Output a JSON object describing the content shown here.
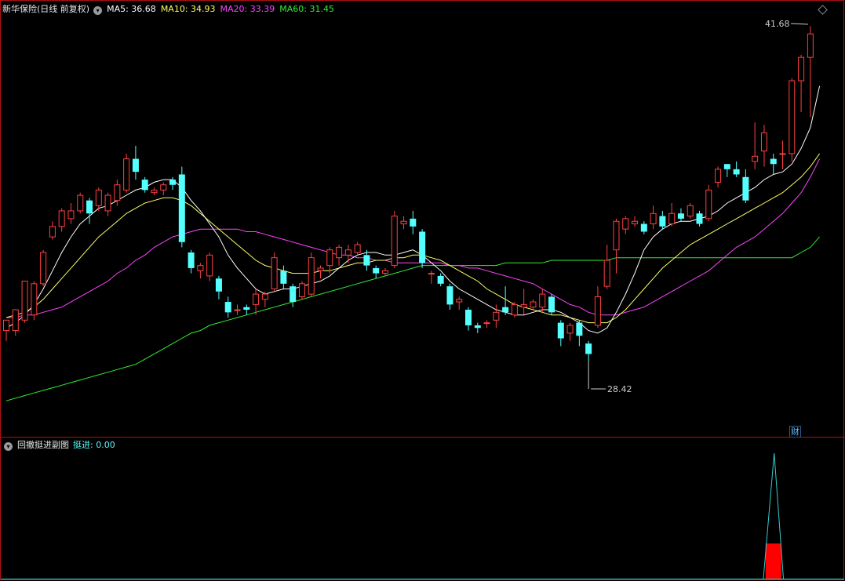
{
  "main_panel": {
    "title": "新华保险(日线 前复权)",
    "ma_values": [
      {
        "label": "MA5: 36.68",
        "color": "#ffffff"
      },
      {
        "label": "MA10: 34.93",
        "color": "#ffff66"
      },
      {
        "label": "MA20: 33.39",
        "color": "#ff44ff"
      },
      {
        "label": "MA60: 31.45",
        "color": "#33ee33"
      }
    ],
    "max_label": "41.68",
    "min_label": "28.42",
    "finance_badge": "财"
  },
  "sub_panel": {
    "title": "回撤挺进副图",
    "indicator_label": "挺进: 0.00"
  },
  "colors": {
    "up": "#ff4040",
    "down": "#54ffff",
    "frame": "#b01010",
    "ma5": "#ffffff",
    "ma10": "#ffff66",
    "ma20": "#ff44ff",
    "ma60": "#33ee33",
    "spike": "#33cccc",
    "bar": "#ff0000"
  },
  "chart_data": {
    "type": "candlestick",
    "y_range": [
      26.0,
      42.2
    ],
    "candles": [
      [
        30.0,
        30.4,
        29.6,
        30.2
      ],
      [
        30.0,
        30.8,
        29.8,
        30.6
      ],
      [
        30.4,
        31.9,
        30.3,
        31.8
      ],
      [
        30.6,
        31.8,
        30.4,
        31.9
      ],
      [
        31.8,
        33.0,
        31.7,
        33.1
      ],
      [
        33.6,
        34.0,
        33.5,
        34.2
      ],
      [
        34.0,
        34.6,
        33.8,
        34.7
      ],
      [
        34.3,
        34.6,
        34.1,
        34.9
      ],
      [
        34.6,
        35.2,
        34.5,
        35.3
      ],
      [
        35.0,
        34.5,
        34.1,
        35.1
      ],
      [
        34.8,
        35.4,
        34.6,
        35.5
      ],
      [
        34.6,
        35.2,
        34.4,
        35.3
      ],
      [
        35.0,
        35.6,
        34.8,
        35.8
      ],
      [
        35.4,
        36.6,
        35.3,
        36.8
      ],
      [
        36.6,
        36.1,
        35.8,
        37.1
      ],
      [
        35.8,
        35.4,
        35.3,
        35.9
      ],
      [
        35.3,
        35.4,
        35.2,
        35.5
      ],
      [
        35.4,
        35.6,
        35.2,
        35.7
      ],
      [
        35.8,
        35.6,
        35.4,
        35.9
      ],
      [
        36.0,
        33.4,
        33.2,
        36.3
      ],
      [
        33.0,
        32.4,
        32.2,
        33.1
      ],
      [
        32.3,
        32.5,
        32.0,
        32.6
      ],
      [
        32.1,
        32.9,
        31.9,
        33.0
      ],
      [
        32.0,
        31.5,
        31.2,
        32.1
      ],
      [
        31.1,
        30.7,
        30.5,
        31.3
      ],
      [
        30.8,
        30.8,
        30.6,
        31.0
      ],
      [
        30.9,
        30.8,
        30.6,
        31.0
      ],
      [
        31.0,
        31.4,
        30.6,
        31.6
      ],
      [
        31.2,
        31.4,
        30.9,
        31.5
      ],
      [
        31.6,
        32.8,
        31.5,
        33.0
      ],
      [
        32.3,
        31.8,
        31.6,
        32.5
      ],
      [
        31.7,
        31.1,
        30.9,
        31.8
      ],
      [
        31.3,
        31.8,
        31.2,
        31.9
      ],
      [
        31.4,
        32.8,
        31.3,
        33.0
      ],
      [
        32.3,
        32.4,
        32.0,
        32.5
      ],
      [
        32.5,
        33.1,
        32.2,
        33.2
      ],
      [
        32.8,
        33.2,
        32.5,
        33.3
      ],
      [
        32.9,
        33.1,
        32.6,
        33.3
      ],
      [
        33.0,
        33.3,
        32.9,
        33.4
      ],
      [
        32.9,
        32.5,
        32.3,
        33.1
      ],
      [
        32.4,
        32.2,
        32.0,
        32.5
      ],
      [
        32.2,
        32.3,
        32.1,
        32.4
      ],
      [
        32.5,
        34.4,
        32.4,
        34.6
      ],
      [
        34.1,
        34.2,
        33.9,
        34.4
      ],
      [
        34.3,
        34.0,
        33.7,
        34.6
      ],
      [
        33.8,
        32.6,
        32.4,
        33.9
      ],
      [
        32.2,
        32.2,
        31.8,
        32.3
      ],
      [
        32.1,
        31.8,
        31.7,
        32.2
      ],
      [
        31.7,
        31.0,
        30.8,
        31.8
      ],
      [
        31.1,
        31.2,
        30.8,
        31.3
      ],
      [
        30.8,
        30.2,
        30.0,
        30.9
      ],
      [
        30.2,
        30.1,
        29.9,
        30.3
      ],
      [
        30.3,
        30.3,
        30.1,
        30.4
      ],
      [
        30.4,
        30.7,
        30.1,
        31.0
      ],
      [
        30.9,
        30.7,
        30.6,
        31.7
      ],
      [
        30.6,
        31.0,
        30.5,
        31.1
      ],
      [
        30.9,
        31.0,
        30.6,
        31.6
      ],
      [
        30.9,
        31.1,
        30.8,
        31.2
      ],
      [
        30.9,
        31.4,
        30.7,
        31.6
      ],
      [
        31.3,
        30.7,
        30.6,
        31.4
      ],
      [
        30.3,
        29.7,
        29.4,
        30.4
      ],
      [
        29.9,
        30.2,
        29.6,
        30.3
      ],
      [
        30.3,
        29.8,
        29.4,
        30.4
      ],
      [
        29.5,
        29.1,
        28.8,
        29.6
      ],
      [
        30.2,
        31.3,
        30.1,
        31.7
      ],
      [
        31.7,
        32.7,
        31.6,
        33.3
      ],
      [
        33.1,
        34.2,
        32.2,
        34.3
      ],
      [
        33.9,
        34.3,
        33.7,
        34.4
      ],
      [
        34.1,
        34.2,
        34.0,
        34.4
      ],
      [
        34.1,
        33.8,
        33.7,
        34.2
      ],
      [
        34.1,
        34.5,
        33.9,
        34.8
      ],
      [
        34.4,
        34.0,
        33.9,
        34.6
      ],
      [
        34.1,
        34.5,
        34.0,
        34.9
      ],
      [
        34.5,
        34.3,
        34.2,
        34.7
      ],
      [
        34.4,
        34.8,
        34.3,
        34.9
      ],
      [
        34.5,
        34.1,
        34.0,
        34.6
      ],
      [
        34.3,
        35.4,
        34.2,
        35.6
      ],
      [
        35.7,
        36.2,
        35.5,
        36.3
      ],
      [
        36.4,
        36.2,
        35.9,
        36.4
      ],
      [
        36.2,
        36.0,
        35.9,
        36.5
      ],
      [
        35.9,
        35.0,
        34.9,
        36.2
      ],
      [
        36.5,
        36.7,
        36.2,
        38.0
      ],
      [
        36.9,
        37.6,
        36.3,
        37.9
      ],
      [
        36.6,
        36.4,
        36.0,
        36.8
      ],
      [
        36.8,
        36.8,
        36.2,
        37.3
      ],
      [
        36.8,
        39.6,
        36.5,
        39.7
      ],
      [
        39.6,
        40.5,
        38.4,
        40.6
      ],
      [
        40.5,
        41.4,
        38.2,
        41.7
      ]
    ],
    "ma5": [
      30.1,
      30.3,
      30.6,
      31.0,
      31.6,
      32.3,
      33.0,
      33.6,
      34.1,
      34.4,
      34.7,
      34.8,
      35.0,
      35.2,
      35.4,
      35.5,
      35.7,
      35.8,
      35.8,
      35.5,
      35.0,
      34.6,
      34.1,
      33.6,
      32.9,
      32.4,
      32.0,
      31.6,
      31.4,
      31.5,
      31.6,
      31.6,
      31.7,
      31.8,
      31.9,
      32.1,
      32.4,
      32.7,
      32.9,
      33.0,
      33.0,
      32.9,
      32.9,
      33.0,
      33.1,
      32.9,
      32.6,
      32.3,
      31.9,
      31.6,
      31.4,
      31.2,
      31.0,
      30.8,
      30.7,
      30.6,
      30.6,
      30.7,
      30.8,
      30.8,
      30.7,
      30.5,
      30.3,
      30.0,
      29.9,
      30.1,
      30.7,
      31.4,
      32.2,
      33.1,
      33.6,
      33.9,
      34.1,
      34.2,
      34.2,
      34.3,
      34.4,
      34.6,
      34.9,
      35.1,
      35.3,
      35.5,
      35.8,
      36.0,
      36.1,
      36.4,
      37.0,
      37.8,
      39.4
    ],
    "ma10": [
      30.5,
      30.6,
      30.7,
      30.9,
      31.2,
      31.6,
      32.0,
      32.4,
      32.8,
      33.2,
      33.6,
      33.9,
      34.2,
      34.5,
      34.7,
      34.9,
      35.0,
      35.1,
      35.1,
      35.0,
      34.8,
      34.5,
      34.2,
      33.9,
      33.6,
      33.3,
      33.0,
      32.7,
      32.5,
      32.4,
      32.3,
      32.2,
      32.2,
      32.2,
      32.3,
      32.3,
      32.4,
      32.5,
      32.6,
      32.6,
      32.7,
      32.7,
      32.8,
      32.8,
      32.9,
      32.9,
      32.8,
      32.7,
      32.5,
      32.3,
      32.1,
      31.9,
      31.6,
      31.4,
      31.2,
      31.0,
      30.9,
      30.8,
      30.7,
      30.6,
      30.6,
      30.5,
      30.4,
      30.3,
      30.3,
      30.3,
      30.5,
      30.8,
      31.2,
      31.6,
      32.0,
      32.4,
      32.7,
      33.0,
      33.3,
      33.5,
      33.7,
      33.9,
      34.1,
      34.3,
      34.5,
      34.7,
      34.9,
      35.1,
      35.3,
      35.6,
      35.9,
      36.3,
      36.8
    ],
    "ma20": [
      30.5,
      30.5,
      30.6,
      30.6,
      30.7,
      30.8,
      30.9,
      31.1,
      31.3,
      31.5,
      31.7,
      31.9,
      32.2,
      32.4,
      32.7,
      32.9,
      33.2,
      33.4,
      33.6,
      33.7,
      33.8,
      33.9,
      33.9,
      33.9,
      33.9,
      33.9,
      33.8,
      33.8,
      33.7,
      33.6,
      33.5,
      33.4,
      33.3,
      33.2,
      33.1,
      33.0,
      32.9,
      32.9,
      32.8,
      32.8,
      32.7,
      32.7,
      32.6,
      32.6,
      32.6,
      32.6,
      32.6,
      32.6,
      32.5,
      32.5,
      32.4,
      32.4,
      32.3,
      32.2,
      32.1,
      32.0,
      31.9,
      31.8,
      31.6,
      31.4,
      31.2,
      31.0,
      30.9,
      30.7,
      30.6,
      30.6,
      30.6,
      30.7,
      30.8,
      30.9,
      31.1,
      31.3,
      31.5,
      31.7,
      31.9,
      32.1,
      32.3,
      32.6,
      32.9,
      33.2,
      33.4,
      33.6,
      33.9,
      34.2,
      34.5,
      34.9,
      35.3,
      35.9,
      36.6
    ],
    "ma60": [
      27.3,
      27.4,
      27.5,
      27.6,
      27.7,
      27.8,
      27.9,
      28.0,
      28.1,
      28.2,
      28.3,
      28.4,
      28.5,
      28.6,
      28.7,
      28.9,
      29.1,
      29.3,
      29.5,
      29.7,
      29.9,
      30.0,
      30.2,
      30.3,
      30.4,
      30.5,
      30.6,
      30.7,
      30.8,
      30.9,
      31.0,
      31.1,
      31.2,
      31.3,
      31.4,
      31.5,
      31.6,
      31.7,
      31.8,
      31.9,
      32.0,
      32.1,
      32.2,
      32.3,
      32.4,
      32.5,
      32.5,
      32.5,
      32.5,
      32.5,
      32.5,
      32.5,
      32.5,
      32.5,
      32.6,
      32.6,
      32.6,
      32.6,
      32.6,
      32.7,
      32.7,
      32.7,
      32.7,
      32.7,
      32.7,
      32.7,
      32.8,
      32.8,
      32.8,
      32.8,
      32.8,
      32.8,
      32.8,
      32.8,
      32.8,
      32.8,
      32.8,
      32.8,
      32.8,
      32.8,
      32.8,
      32.8,
      32.8,
      32.8,
      32.8,
      32.8,
      33.0,
      33.2,
      33.6
    ],
    "sub_spike": {
      "index": 83,
      "base_index_from": 82,
      "base_index_to": 84,
      "value": 1.0,
      "bar_value": 0.28
    }
  }
}
